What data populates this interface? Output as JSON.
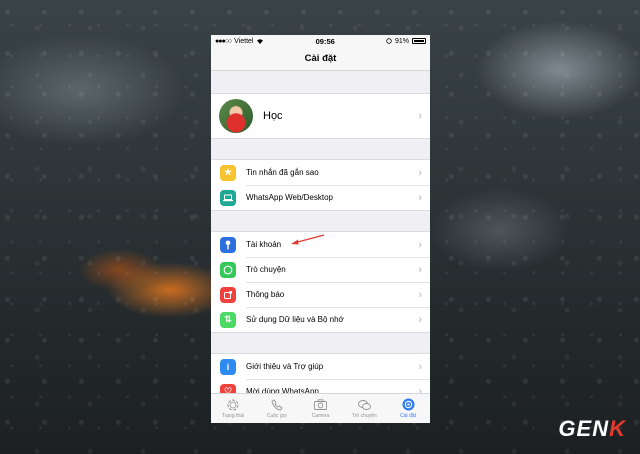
{
  "status_bar": {
    "carrier": "Viettel",
    "time": "09:56",
    "battery": "91%"
  },
  "nav": {
    "title": "Cài đặt"
  },
  "profile": {
    "name": "Học"
  },
  "groups": [
    {
      "items": [
        {
          "label": "Tin nhắn đã gắn sao",
          "icon": "star-icon",
          "color": "#f7c32e"
        },
        {
          "label": "WhatsApp Web/Desktop",
          "icon": "laptop-icon",
          "color": "#1ea895"
        }
      ]
    },
    {
      "items": [
        {
          "label": "Tài khoản",
          "icon": "key-icon",
          "color": "#2e6fe0"
        },
        {
          "label": "Trò chuyện",
          "icon": "whatsapp-icon",
          "color": "#34c759"
        },
        {
          "label": "Thông báo",
          "icon": "notification-icon",
          "color": "#f0413a"
        },
        {
          "label": "Sử dụng Dữ liệu và Bộ nhớ",
          "icon": "data-arrows-icon",
          "color": "#4cd964"
        }
      ]
    },
    {
      "items": [
        {
          "label": "Giới thiệu và Trợ giúp",
          "icon": "info-icon",
          "color": "#2e8cf0"
        },
        {
          "label": "Mời dùng WhatsApp",
          "icon": "heart-icon",
          "color": "#f0413a"
        }
      ]
    }
  ],
  "tabs": [
    {
      "label": "Trạng thái",
      "icon": "status-icon",
      "active": false
    },
    {
      "label": "Cuộc gọi",
      "icon": "phone-icon",
      "active": false
    },
    {
      "label": "Camera",
      "icon": "camera-icon",
      "active": false
    },
    {
      "label": "Trò chuyện",
      "icon": "chats-icon",
      "active": false
    },
    {
      "label": "Cài đặt",
      "icon": "settings-icon",
      "active": true
    }
  ],
  "watermark": {
    "text_main": "GEN",
    "text_accent": "K"
  }
}
